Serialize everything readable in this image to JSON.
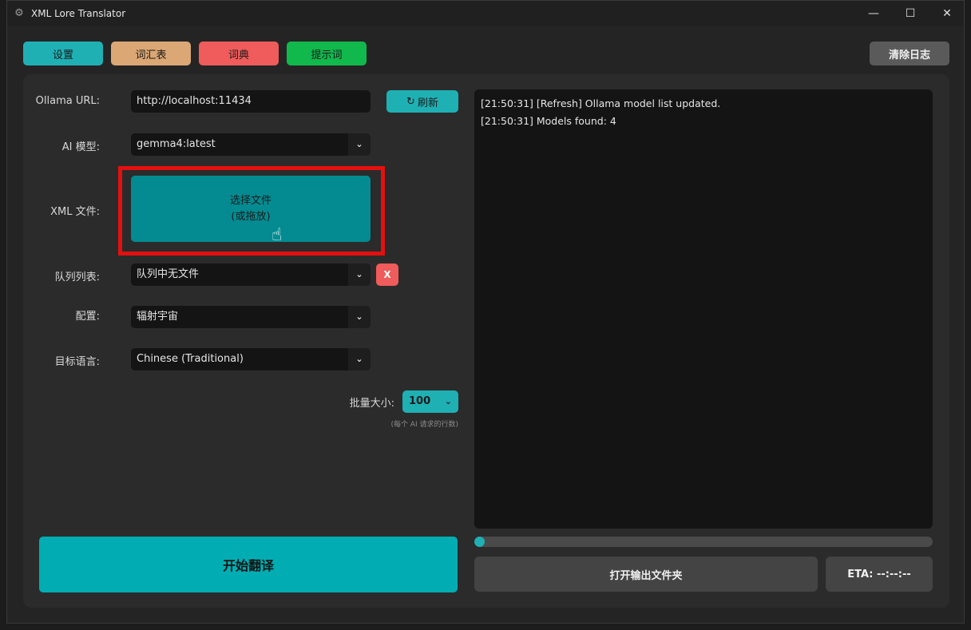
{
  "window": {
    "title": "XML Lore Translator",
    "minimize_glyph": "—",
    "maximize_glyph": "☐",
    "close_glyph": "✕"
  },
  "toolbar": {
    "settings_label": "设置",
    "vocab_label": "词汇表",
    "dictionary_label": "词典",
    "prompt_label": "提示词",
    "clear_log_label": "清除日志"
  },
  "form": {
    "ollama_url": {
      "label": "Ollama URL:",
      "value": "http://localhost:11434"
    },
    "refresh_label": "刷新",
    "model": {
      "label": "AI 模型:",
      "value": "gemma4:latest"
    },
    "xml_file": {
      "label": "XML 文件:",
      "button_line1": "选择文件",
      "button_line2": "(或拖放)"
    },
    "queue": {
      "label": "队列列表:",
      "value": "队列中无文件",
      "remove_label": "X"
    },
    "profile": {
      "label": "配置:",
      "value": "辐射宇宙"
    },
    "target_language": {
      "label": "目标语言:",
      "value": "Chinese (Traditional)"
    },
    "batch": {
      "label": "批量大小:",
      "value": "100",
      "hint": "(每个 AI 请求的行数)"
    }
  },
  "start_label": "开始翻译",
  "log": {
    "lines": [
      "[21:50:31]  [Refresh] Ollama model list updated.",
      "[21:50:31]  Models found: 4"
    ]
  },
  "progress": {
    "value": 0
  },
  "open_folder_label": "打开输出文件夹",
  "eta_label": "ETA: --:--:--",
  "icons": {
    "app": "gear-icon",
    "refresh": "refresh-icon",
    "dropdown": "chevron-down-icon",
    "cursor": "hand-pointer-icon"
  },
  "colors": {
    "accent": "#1fb0b4",
    "file_button": "#038b91",
    "vocab": "#dba774",
    "dictionary": "#f05b5b",
    "prompt": "#11b84c",
    "highlight": "#e41010"
  }
}
